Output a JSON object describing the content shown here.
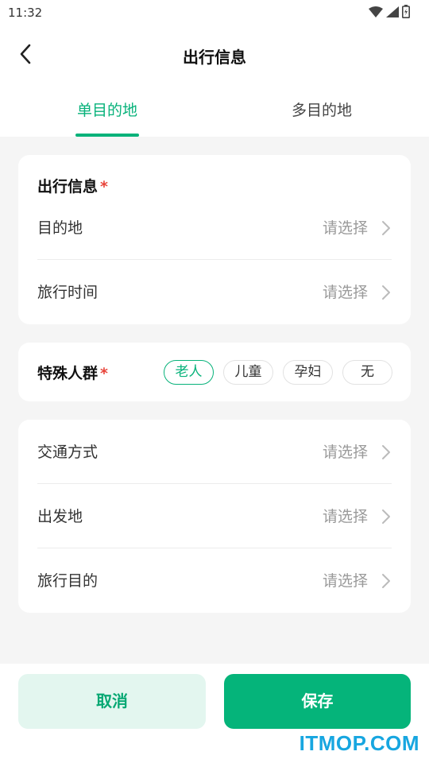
{
  "status_bar": {
    "time": "11:32",
    "icons": [
      "wifi-icon",
      "signal-icon",
      "battery-icon"
    ]
  },
  "header": {
    "title": "出行信息",
    "back_icon": "chevron-left-icon"
  },
  "tabs": [
    {
      "label": "单目的地",
      "active": true
    },
    {
      "label": "多目的地",
      "active": false
    }
  ],
  "travel_info": {
    "heading": "出行信息",
    "required": "*",
    "rows": [
      {
        "label": "目的地",
        "value": "请选择"
      },
      {
        "label": "旅行时间",
        "value": "请选择"
      }
    ]
  },
  "special_group": {
    "heading": "特殊人群",
    "required": "*",
    "options": [
      {
        "label": "老人",
        "selected": true
      },
      {
        "label": "儿童",
        "selected": false
      },
      {
        "label": "孕妇",
        "selected": false
      },
      {
        "label": "无",
        "selected": false
      }
    ]
  },
  "other_info": {
    "rows": [
      {
        "label": "交通方式",
        "value": "请选择"
      },
      {
        "label": "出发地",
        "value": "请选择"
      },
      {
        "label": "旅行目的",
        "value": "请选择"
      }
    ]
  },
  "actions": {
    "cancel": "取消",
    "save": "保存"
  },
  "watermark": "ITMOP.COM",
  "colors": {
    "accent": "#07b27a",
    "required": "#e8443a",
    "cancel_bg": "#e3f6ef",
    "watermark": "#17a6e0"
  }
}
